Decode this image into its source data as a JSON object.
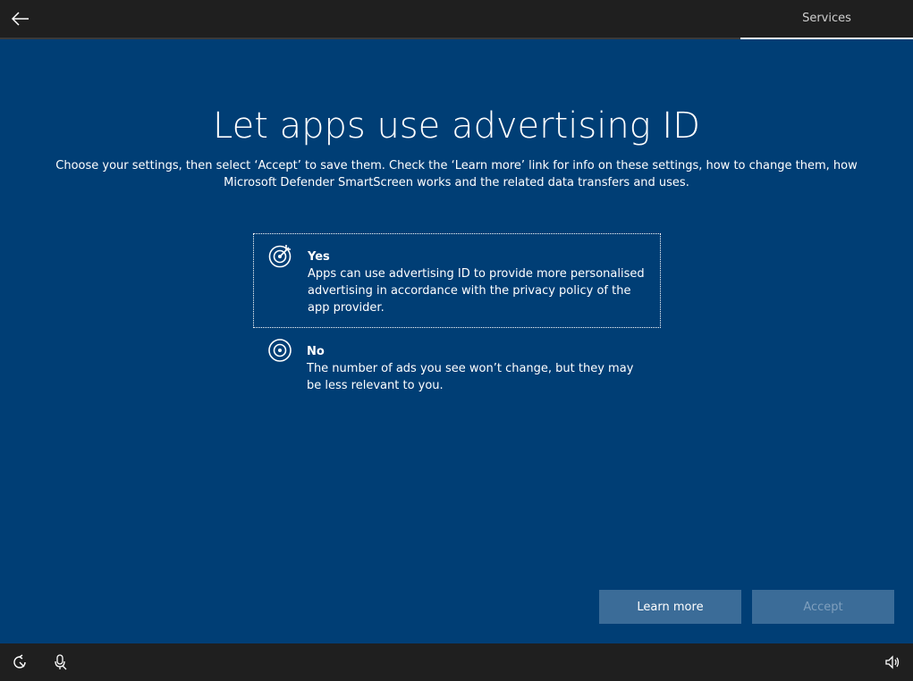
{
  "header": {
    "back_icon": "back-arrow-icon",
    "step_label": "Services"
  },
  "main": {
    "title": "Let apps use advertising ID",
    "subtitle_line1": "Choose your settings, then select ‘Accept’ to save them. Check the ‘Learn more’ link for info on these settings, how to change them, how",
    "subtitle_line2": "Microsoft Defender SmartScreen works and the related data transfers and uses.",
    "options": [
      {
        "title": "Yes",
        "description": "Apps can use advertising ID to provide more personalised advertising in accordance with the privacy policy of the app provider.",
        "icon": "target-arrow-icon",
        "selected": true
      },
      {
        "title": "No",
        "description": "The number of ads you see won’t change, but they may be less relevant to you.",
        "icon": "target-icon",
        "selected": false
      }
    ]
  },
  "buttons": {
    "learn_more": "Learn more",
    "accept": "Accept"
  },
  "footer": {
    "icons": [
      "ease-of-access-icon",
      "microphone-icon",
      "volume-icon"
    ]
  },
  "colors": {
    "background": "#003e75",
    "bar": "#1f1f1f",
    "button": "#3b6c98",
    "button_disabled_text": "#7f9fbd"
  }
}
